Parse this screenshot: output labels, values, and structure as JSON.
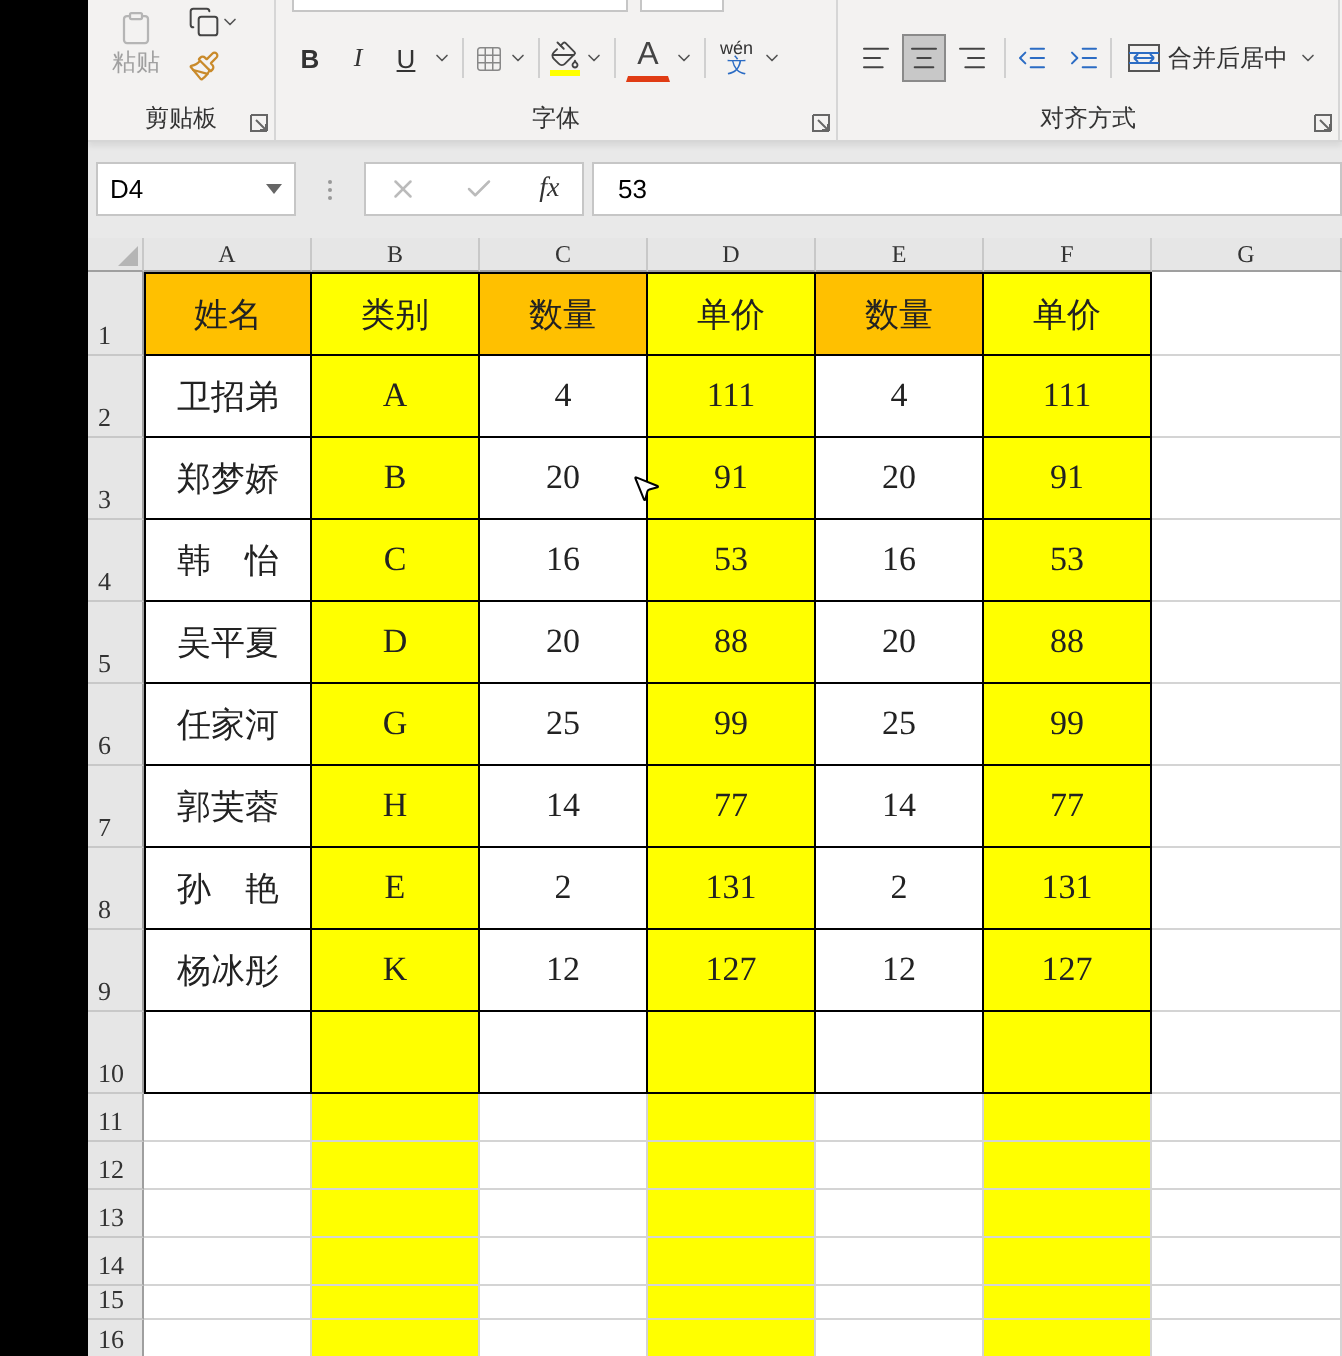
{
  "ribbon": {
    "clipboard": {
      "paste_label": "粘贴",
      "group_label": "剪贴板"
    },
    "font": {
      "style_buttons": [
        {
          "kind": "bold",
          "label": "B"
        },
        {
          "kind": "italic",
          "label": "I"
        },
        {
          "kind": "underline",
          "label": "U"
        }
      ],
      "font_color_label": "A",
      "phonetic": {
        "pinyin": "wén",
        "char": "文"
      },
      "group_label": "字体"
    },
    "alignment": {
      "align_buttons": [
        {
          "kind": "left",
          "selected": false
        },
        {
          "kind": "center",
          "selected": true
        },
        {
          "kind": "right",
          "selected": false
        }
      ],
      "merge_label": "合并后居中",
      "group_label": "对齐方式"
    }
  },
  "formula_bar": {
    "name_box": "D4",
    "fx_label": "fx",
    "value": "53"
  },
  "sheet": {
    "columns": [
      {
        "letter": "A",
        "color": "#ffffff"
      },
      {
        "letter": "B",
        "color": "#ffff00"
      },
      {
        "letter": "C",
        "color": "#ffffff"
      },
      {
        "letter": "D",
        "color": "#ffff00"
      },
      {
        "letter": "E",
        "color": "#ffffff"
      },
      {
        "letter": "F",
        "color": "#ffff00"
      },
      {
        "letter": "G",
        "color": "#ffffff"
      }
    ],
    "header_row": {
      "number": "1",
      "cells": [
        {
          "text": "姓名",
          "color": "#ffc000"
        },
        {
          "text": "类别",
          "color": "#ffff00"
        },
        {
          "text": "数量",
          "color": "#ffc000"
        },
        {
          "text": "单价",
          "color": "#ffff00"
        },
        {
          "text": "数量",
          "color": "#ffc000"
        },
        {
          "text": "单价",
          "color": "#ffff00"
        }
      ]
    },
    "rows": [
      {
        "number": "2",
        "cells": [
          "卫招弟",
          "A",
          "4",
          "111",
          "4",
          "111"
        ]
      },
      {
        "number": "3",
        "cells": [
          "郑梦娇",
          "B",
          "20",
          "91",
          "20",
          "91"
        ]
      },
      {
        "number": "4",
        "cells": [
          "韩　怡",
          "C",
          "16",
          "53",
          "16",
          "53"
        ]
      },
      {
        "number": "5",
        "cells": [
          "吴平夏",
          "D",
          "20",
          "88",
          "20",
          "88"
        ]
      },
      {
        "number": "6",
        "cells": [
          "任家河",
          "G",
          "25",
          "99",
          "25",
          "99"
        ]
      },
      {
        "number": "7",
        "cells": [
          "郭芙蓉",
          "H",
          "14",
          "77",
          "14",
          "77"
        ]
      },
      {
        "number": "8",
        "cells": [
          "孙　艳",
          "E",
          "2",
          "131",
          "2",
          "131"
        ]
      },
      {
        "number": "9",
        "cells": [
          "杨冰彤",
          "K",
          "12",
          "127",
          "12",
          "127"
        ]
      },
      {
        "number": "10",
        "cells": []
      }
    ],
    "empty_rows": [
      "11",
      "12",
      "13",
      "14",
      "15",
      "16"
    ]
  }
}
